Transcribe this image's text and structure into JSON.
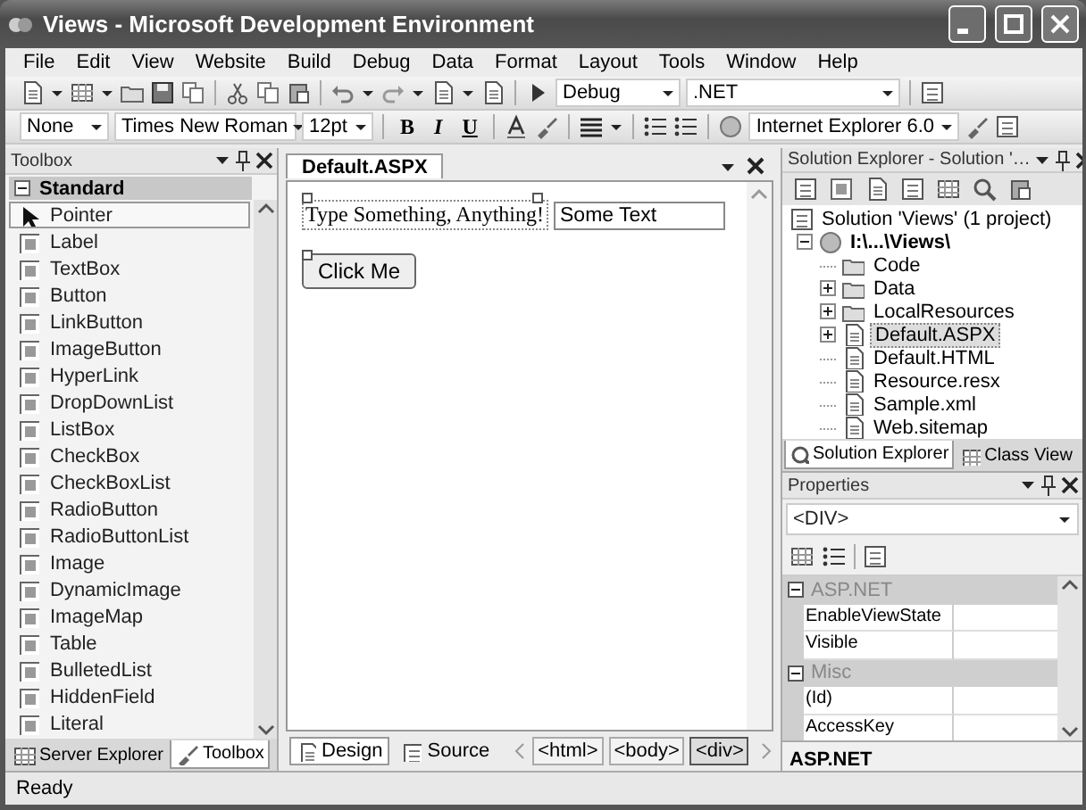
{
  "window": {
    "title": "Views - Microsoft Development Environment"
  },
  "menu": [
    {
      "label": "File"
    },
    {
      "label": "Edit"
    },
    {
      "label": "View"
    },
    {
      "label": "Website"
    },
    {
      "label": "Build"
    },
    {
      "label": "Debug"
    },
    {
      "label": "Data"
    },
    {
      "label": "Format"
    },
    {
      "label": "Layout"
    },
    {
      "label": "Tools"
    },
    {
      "label": "Window"
    },
    {
      "label": "Help"
    }
  ],
  "standard_toolbar": {
    "configuration": "Debug",
    "platform": ".NET"
  },
  "formatting_toolbar": {
    "block_format": "None",
    "font": "Times New Roman",
    "size": "12pt",
    "bold": "B",
    "italic": "I",
    "underline": "U",
    "target": "Internet Explorer 6.0"
  },
  "toolbox": {
    "title": "Toolbox",
    "group": {
      "label": "Standard",
      "expanded": true
    },
    "items": [
      {
        "label": "Pointer",
        "selected": true
      },
      {
        "label": "Label",
        "selected": false
      },
      {
        "label": "TextBox",
        "selected": false
      },
      {
        "label": "Button",
        "selected": false
      },
      {
        "label": "LinkButton",
        "selected": false
      },
      {
        "label": "ImageButton",
        "selected": false
      },
      {
        "label": "HyperLink",
        "selected": false
      },
      {
        "label": "DropDownList",
        "selected": false
      },
      {
        "label": "ListBox",
        "selected": false
      },
      {
        "label": "CheckBox",
        "selected": false
      },
      {
        "label": "CheckBoxList",
        "selected": false
      },
      {
        "label": "RadioButton",
        "selected": false
      },
      {
        "label": "RadioButtonList",
        "selected": false
      },
      {
        "label": "Image",
        "selected": false
      },
      {
        "label": "DynamicImage",
        "selected": false
      },
      {
        "label": "ImageMap",
        "selected": false
      },
      {
        "label": "Table",
        "selected": false
      },
      {
        "label": "BulletedList",
        "selected": false
      },
      {
        "label": "HiddenField",
        "selected": false
      },
      {
        "label": "Literal",
        "selected": false
      }
    ],
    "tabs": [
      {
        "label": "Server Explorer",
        "selected": false
      },
      {
        "label": "Toolbox",
        "selected": true
      }
    ]
  },
  "editor": {
    "tab": "Default.ASPX",
    "label_text": "Type Something, Anything!",
    "textbox_value": "Some Text",
    "button_label": "Click Me",
    "view_tabs": [
      {
        "label": "Design",
        "selected": true
      },
      {
        "label": "Source",
        "selected": false
      }
    ],
    "tag_path": [
      {
        "label": "<html>",
        "selected": false
      },
      {
        "label": "<body>",
        "selected": false
      },
      {
        "label": "<div>",
        "selected": true
      }
    ]
  },
  "solution_explorer": {
    "title": "Solution Explorer - Solution '…",
    "tree": [
      {
        "label": "Solution 'Views' (1 project)",
        "kind": "solution",
        "selected": false,
        "children": [
          {
            "label": "I:\\...\\Views\\",
            "kind": "project",
            "expanded": true,
            "selected": false,
            "children": [
              {
                "label": "Code",
                "kind": "folder",
                "selected": false
              },
              {
                "label": "Data",
                "kind": "folder",
                "expanded": false,
                "selected": false
              },
              {
                "label": "LocalResources",
                "kind": "folder",
                "expanded": false,
                "selected": false
              },
              {
                "label": "Default.ASPX",
                "kind": "file",
                "expanded": false,
                "selected": true
              },
              {
                "label": "Default.HTML",
                "kind": "file",
                "selected": false
              },
              {
                "label": "Resource.resx",
                "kind": "file",
                "selected": false
              },
              {
                "label": "Sample.xml",
                "kind": "file",
                "selected": false
              },
              {
                "label": "Web.sitemap",
                "kind": "file",
                "selected": false
              }
            ]
          }
        ]
      }
    ],
    "tabs": [
      {
        "label": "Solution Explorer",
        "selected": true
      },
      {
        "label": "Class View",
        "selected": false
      }
    ]
  },
  "properties": {
    "title": "Properties",
    "object": "<DIV>",
    "categories": [
      {
        "name": "ASP.NET",
        "expanded": true,
        "rows": [
          {
            "name": "EnableViewState"
          },
          {
            "name": "Visible"
          }
        ]
      },
      {
        "name": "Misc",
        "expanded": true,
        "rows": [
          {
            "name": "(Id)"
          },
          {
            "name": "AccessKey"
          }
        ]
      }
    ],
    "description": "ASP.NET"
  },
  "status_bar": {
    "text": "Ready"
  }
}
